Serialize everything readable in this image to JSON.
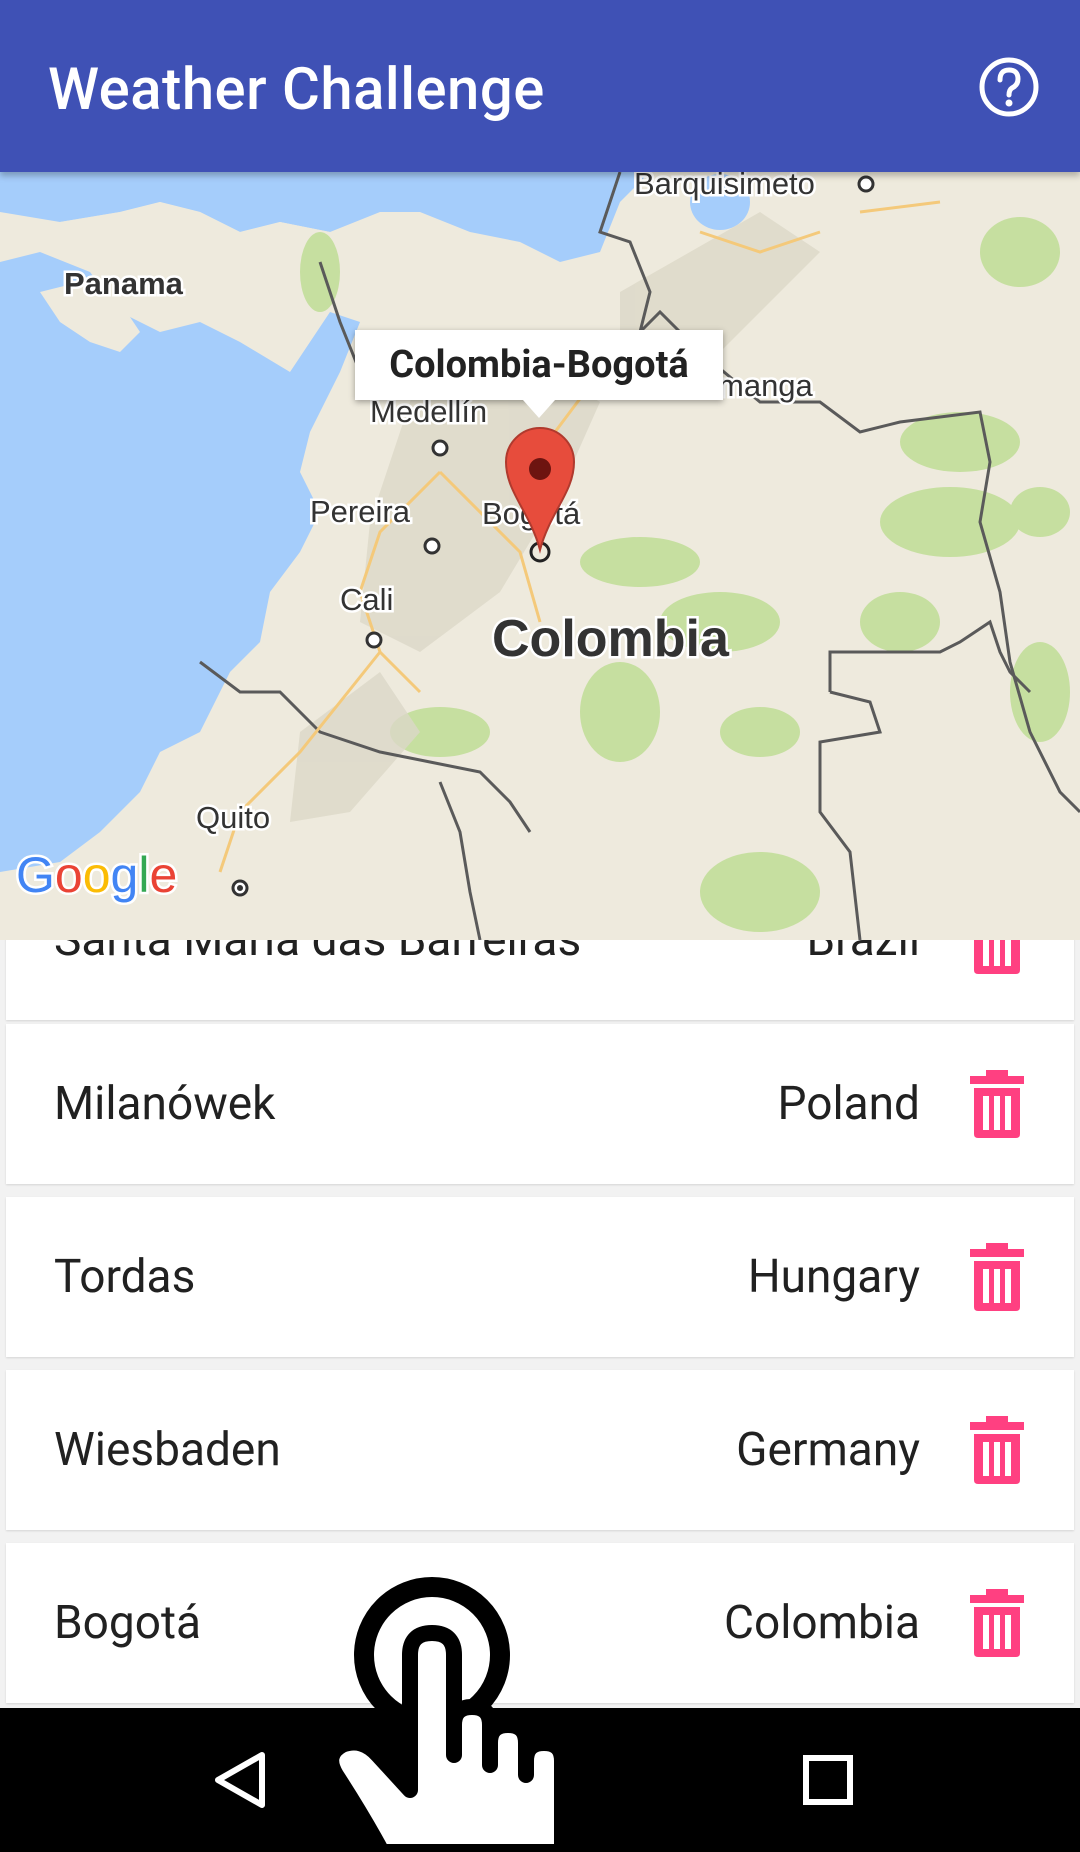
{
  "appbar": {
    "title": "Weather Challenge",
    "help_icon": "help-circle-icon"
  },
  "map": {
    "info_window": "Colombia-Bogotá",
    "attribution": "Google",
    "labels": [
      {
        "name": "barquisimeto",
        "text": "Barquisimeto"
      },
      {
        "name": "panama",
        "text": "Panama"
      },
      {
        "name": "bucaramanga",
        "text": "manga"
      },
      {
        "name": "medellin",
        "text": "Medellín"
      },
      {
        "name": "pereira",
        "text": "Pereira"
      },
      {
        "name": "bogota",
        "text": "Bogotá"
      },
      {
        "name": "cali",
        "text": "Cali"
      },
      {
        "name": "colombia",
        "text": "Colombia"
      },
      {
        "name": "quito",
        "text": "Quito"
      }
    ]
  },
  "list": {
    "rows": [
      {
        "city": "Santa Maria das Barreiras",
        "country": "Brazil"
      },
      {
        "city": "Milanówek",
        "country": "Poland"
      },
      {
        "city": "Tordas",
        "country": "Hungary"
      },
      {
        "city": "Wiesbaden",
        "country": "Germany"
      },
      {
        "city": "Bogotá",
        "country": "Colombia"
      }
    ],
    "delete_icon": "trash-icon",
    "delete_color": "#ff4081"
  },
  "navbar": {
    "back_icon": "back-triangle-icon",
    "recents_icon": "recents-square-icon"
  },
  "colors": {
    "appbar": "#3f51b5",
    "water": "#a5cdfb",
    "land": "#eeeadd",
    "marker": "#e74c3c"
  }
}
